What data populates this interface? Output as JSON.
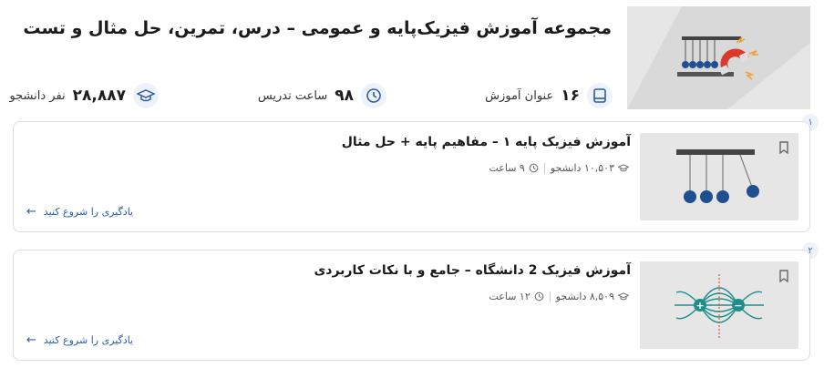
{
  "collection": {
    "title": "مجموعه آموزش فیزیک‌پایه و عمومی – درس، تمرین، حل مثال و تست",
    "hero_image_icon": "newtons-cradle-magnet-illustration"
  },
  "stats": {
    "lessons": {
      "value": "۱۶",
      "label": "عنوان آموزش",
      "icon": "book-icon"
    },
    "hours": {
      "value": "۹۸",
      "label": "ساعت تدریس",
      "icon": "clock-icon"
    },
    "students": {
      "value": "۲۸,۸۸۷",
      "label": "نفر دانشجو",
      "icon": "graduation-cap-icon"
    }
  },
  "courses": [
    {
      "index": "۱",
      "title": "آموزش فیزیک پایه ۱ – مفاهیم پایه + حل مثال",
      "students": "۱۰,۵۰۳ دانشجو",
      "hours": "۹ ساعت",
      "start_label": "یادگیری را شروع کنید",
      "thumb_icon": "newtons-cradle-illustration"
    },
    {
      "index": "۲",
      "title": "آموزش فیزیک 2 دانشگاه – جامع و با نکات کاربردی",
      "students": "۸,۵۰۹ دانشجو",
      "hours": "۱۲ ساعت",
      "start_label": "یادگیری را شروع کنید",
      "thumb_icon": "electric-dipole-field-illustration"
    }
  ],
  "colors": {
    "accent": "#2a5db0",
    "icon_bg": "#eef3fb",
    "thumb_bg": "#e6e6e6",
    "teal": "#1e8e8a",
    "ball_blue": "#1d4f91"
  }
}
